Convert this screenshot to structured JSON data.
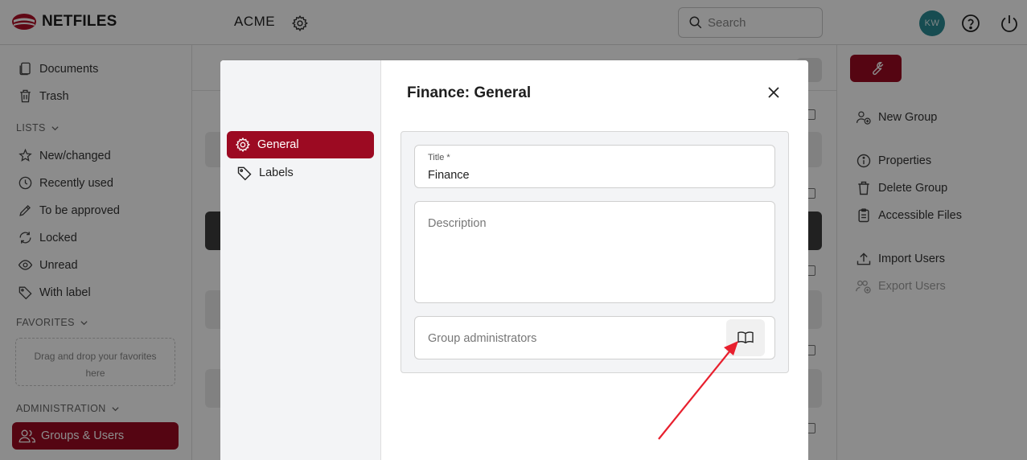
{
  "app": {
    "logo_text": "NETFILES",
    "workspace": "ACME",
    "search_placeholder": "Search",
    "user_initials": "KW"
  },
  "sidebar": {
    "items": [
      {
        "label": "Documents",
        "icon": "documents-icon"
      },
      {
        "label": "Trash",
        "icon": "trash-icon"
      }
    ],
    "lists_label": "LISTS",
    "lists": [
      {
        "label": "New/changed",
        "icon": "sparkle-icon"
      },
      {
        "label": "Recently used",
        "icon": "clock-icon"
      },
      {
        "label": "To be approved",
        "icon": "pencil-icon"
      },
      {
        "label": "Locked",
        "icon": "refresh-icon"
      },
      {
        "label": "Unread",
        "icon": "eye-icon"
      },
      {
        "label": "With label",
        "icon": "tag-icon"
      }
    ],
    "favorites_label": "FAVORITES",
    "favorites_drop_line1": "Drag and drop your favorites",
    "favorites_drop_line2": "here",
    "admin_label": "ADMINISTRATION",
    "admin_active": "Groups & Users"
  },
  "right_panel": {
    "items": [
      {
        "label": "New Group",
        "icon": "add-group-icon",
        "disabled": false
      },
      {
        "label": "Properties",
        "icon": "info-icon",
        "disabled": false
      },
      {
        "label": "Delete Group",
        "icon": "trash-icon",
        "disabled": false
      },
      {
        "label": "Accessible Files",
        "icon": "clipboard-icon",
        "disabled": false
      },
      {
        "label": "Import Users",
        "icon": "upload-icon",
        "disabled": false
      },
      {
        "label": "Export Users",
        "icon": "export-users-icon",
        "disabled": true
      }
    ]
  },
  "modal": {
    "title": "Finance: General",
    "tabs": [
      {
        "label": "General",
        "active": true
      },
      {
        "label": "Labels",
        "active": false
      }
    ],
    "fields": {
      "title_label": "Title *",
      "title_value": "Finance",
      "description_placeholder": "Description",
      "admins_placeholder": "Group administrators"
    }
  },
  "colors": {
    "accent": "#9c0a22",
    "avatar": "#2a8a94",
    "annotation_arrow": "#e8202e"
  }
}
